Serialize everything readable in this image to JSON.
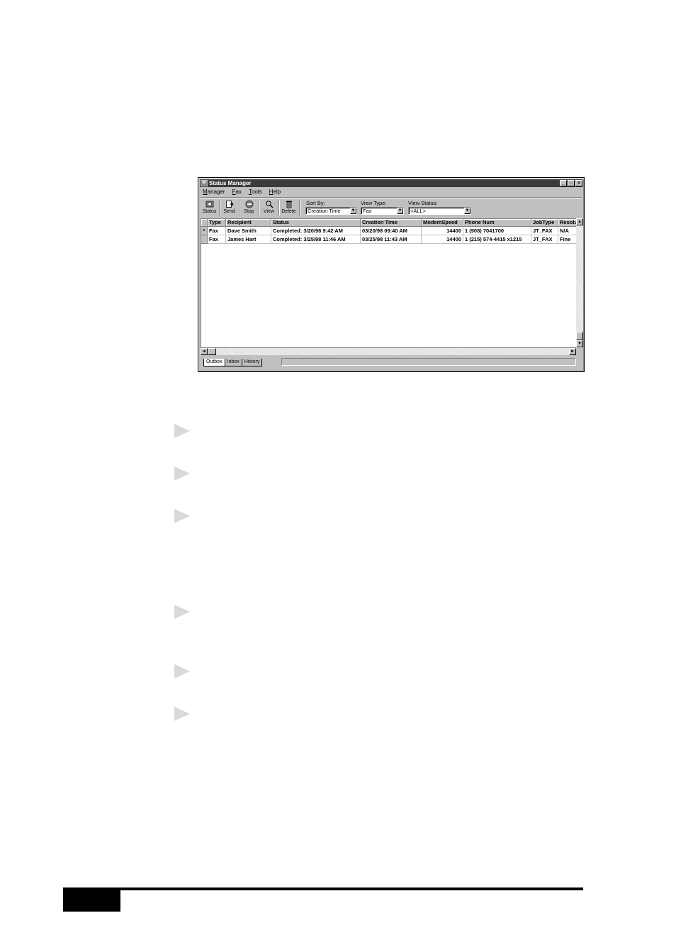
{
  "window": {
    "title": "Status Manager",
    "icon_glyph": "M",
    "controls": [
      "_",
      "□",
      "×"
    ]
  },
  "menu": [
    "Manager",
    "Fax",
    "Tools",
    "Help"
  ],
  "toolbar": {
    "buttons": [
      {
        "label": "Status",
        "icon": "status-icon"
      },
      {
        "label": "Send",
        "icon": "send-icon"
      },
      {
        "label": "Stop",
        "icon": "stop-icon"
      },
      {
        "label": "View",
        "icon": "magnifier-icon"
      },
      {
        "label": "Delete",
        "icon": "trash-icon"
      }
    ],
    "sort_by": {
      "label": "Sort By:",
      "value": "Creation Time"
    },
    "view_type": {
      "label": "View Type:",
      "value": "Fax"
    },
    "view_status": {
      "label": "View Status:",
      "value": "<ALL>"
    }
  },
  "table": {
    "columns": [
      "Type",
      "Recipient",
      "Status",
      "Creation Time",
      "ModemSpeed",
      "Phone Num",
      "JobType",
      "Resolu"
    ],
    "rows": [
      {
        "indicator": "*",
        "cells": [
          "Fax",
          "Dave Smith",
          "Completed: 3/20/98 9:42 AM",
          "03/20/98 09:40 AM",
          "14400",
          "1 (908) 7041700",
          "JT_FAX",
          "N/A"
        ]
      },
      {
        "indicator": "",
        "cells": [
          "Fax",
          "James  Hart",
          "Completed: 3/25/98 11:46 AM",
          "03/25/98 11:43 AM",
          "14400",
          "1 (215) 574-4415 x1215",
          "JT_FAX",
          "Fine"
        ]
      }
    ]
  },
  "tabs": [
    "Outbox",
    "Inbox",
    "History"
  ]
}
